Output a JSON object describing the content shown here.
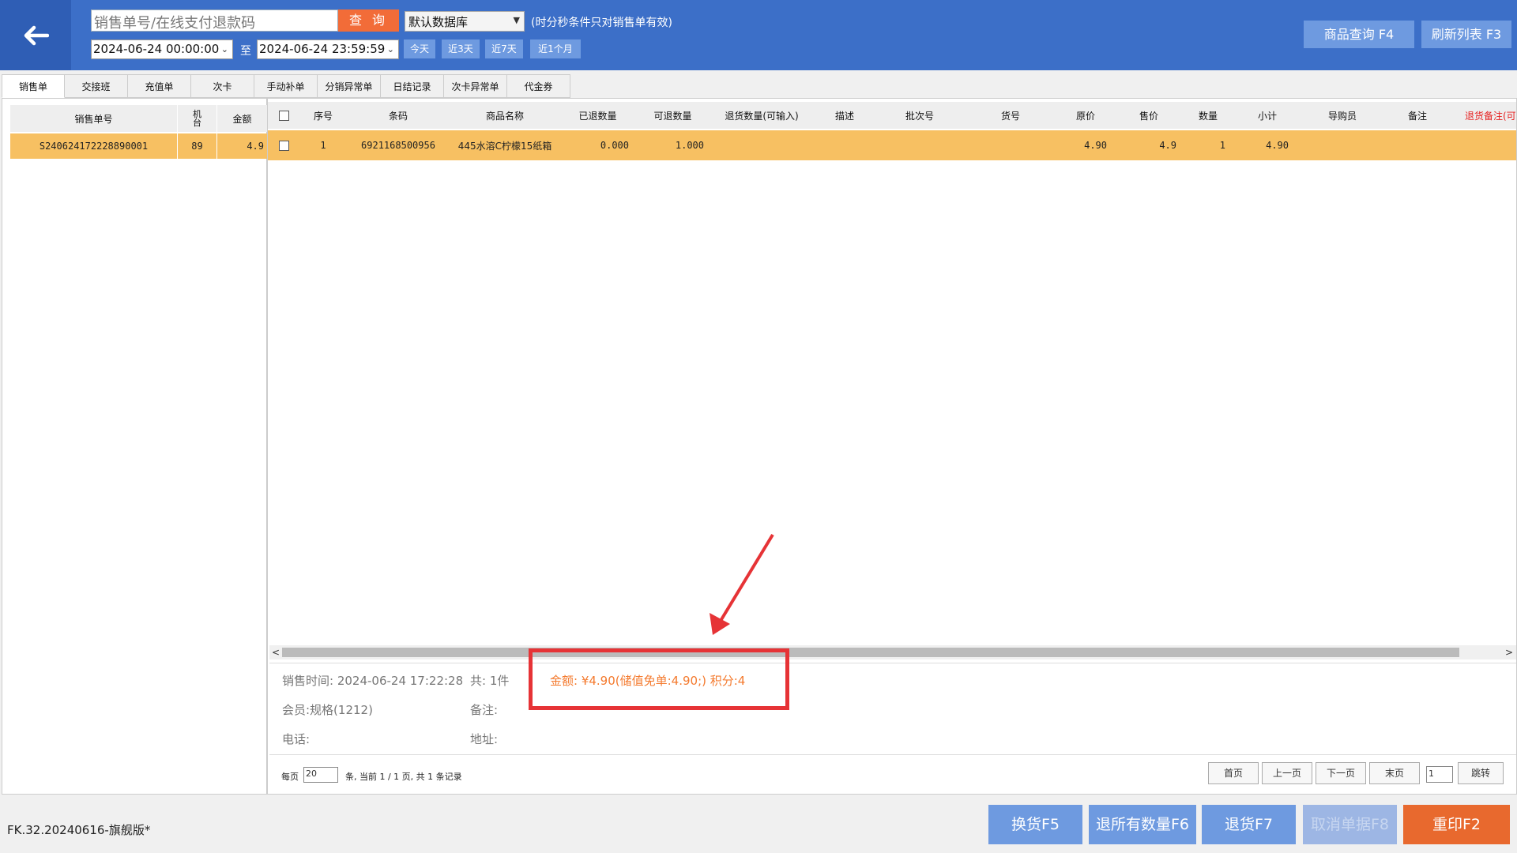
{
  "toolbar": {
    "search_placeholder": "销售单号/在线支付退款码",
    "query_label": "查 询",
    "database": "默认数据库",
    "note": "(时分秒条件只对销售单有效)",
    "start_date": "2024-06-24 00:00:00",
    "to_label": "至",
    "end_date": "2024-06-24 23:59:59",
    "quick": [
      "今天",
      "近3天",
      "近7天",
      "近1个月"
    ],
    "product_query": "商品查询 F4",
    "refresh_list": "刷新列表 F3"
  },
  "tabs": [
    "销售单",
    "交接班",
    "充值单",
    "次卡",
    "手动补单",
    "分销异常单",
    "日结记录",
    "次卡异常单",
    "代金券"
  ],
  "orders": {
    "headers": [
      "销售单号",
      "机台",
      "金额"
    ],
    "rows": [
      {
        "no": "S240624172228890001",
        "machine": "89",
        "amount": "4.9"
      }
    ]
  },
  "items": {
    "headers": [
      "序号",
      "条码",
      "商品名称",
      "已退数量",
      "可退数量",
      "退货数量(可输入)",
      "描述",
      "批次号",
      "货号",
      "原价",
      "售价",
      "数量",
      "小计",
      "导购员",
      "备注",
      "退货备注(可"
    ],
    "rows": [
      {
        "seq": "1",
        "barcode": "6921168500956",
        "name": "445水溶C柠檬15纸箱",
        "returned": "0.000",
        "returnable": "1.000",
        "orig_price": "4.90",
        "price": "4.9",
        "qty": "1",
        "subtotal": "4.90"
      }
    ]
  },
  "detail": {
    "sale_time": "销售时间: 2024-06-24 17:22:28",
    "total": "共: 1件",
    "amount": "金额: ¥4.90(储值免单:4.90;) 积分:4",
    "member": "会员:规格(1212)",
    "remark": "备注:",
    "phone": "电话:",
    "address": "地址:"
  },
  "pager": {
    "per_page_label": "每页",
    "per_page": "20",
    "summary": "条, 当前 1 / 1 页, 共 1 条记录",
    "first": "首页",
    "prev": "上一页",
    "next": "下一页",
    "last": "末页",
    "page": "1",
    "jump": "跳转"
  },
  "footer": {
    "version": "FK.32.20240616-旗舰版*",
    "exchange": "换货F5",
    "return_all": "退所有数量F6",
    "return": "退货F7",
    "cancel": "取消单据F8",
    "reprint": "重印F2"
  },
  "colors": {
    "header_bg": "#3c6fc8",
    "query_button": "#f26c38",
    "selected_row": "#f7c062",
    "amount_text": "#f47a2e",
    "highlight_box": "#e63336",
    "reprint_button": "#e8692e"
  }
}
